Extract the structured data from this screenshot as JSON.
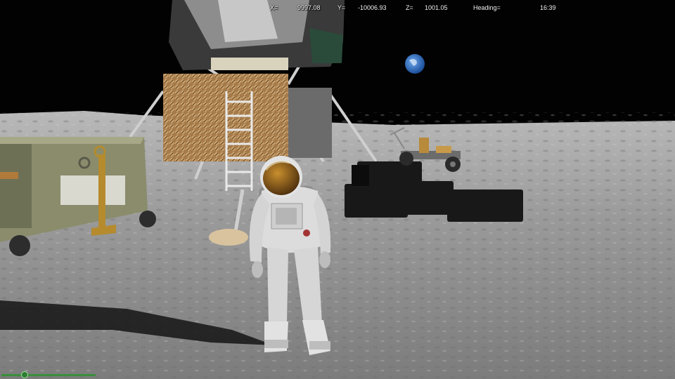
{
  "hud": {
    "x_label": "X=",
    "x_value": "9997.08",
    "y_label": "Y=",
    "y_value": "-10006.93",
    "z_label": "Z=",
    "z_value": "1001.05",
    "heading_label": "Heading=",
    "time": "16:39"
  },
  "colors": {
    "sky": "#020202",
    "ground": "#8d8d8d",
    "earth_blue": "#3b7fd4",
    "module_gold": "#a67c4a",
    "crate_green": "#8a8c6c",
    "minimap_green": "#3a8f3a"
  }
}
